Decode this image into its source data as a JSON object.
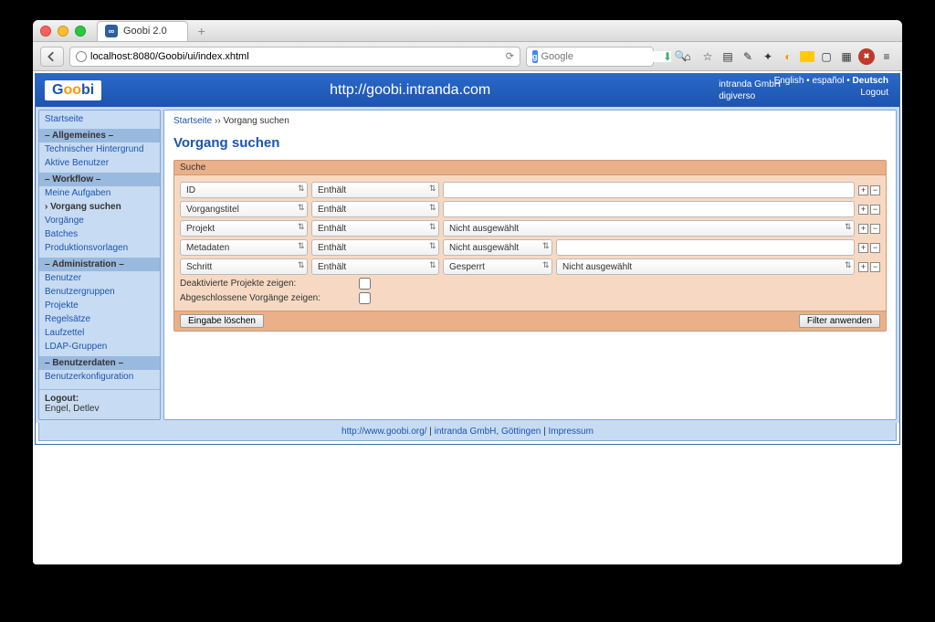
{
  "browser": {
    "tab_title": "Goobi 2.0",
    "url": "localhost:8080/Goobi/ui/index.xhtml",
    "search_placeholder": "Google"
  },
  "header": {
    "logo_prefix": "G",
    "logo_mid": "oo",
    "logo_suffix": "bi",
    "center_url": "http://goobi.intranda.com",
    "company": "intranda GmbH",
    "sub": "digiverso",
    "lang_en": "English",
    "lang_es": "español",
    "lang_de": "Deutsch",
    "logout": "Logout"
  },
  "sidebar": {
    "home": "Startseite",
    "g_allgemeines": "– Allgemeines –",
    "tech": "Technischer Hintergrund",
    "aktive": "Aktive Benutzer",
    "g_workflow": "– Workflow –",
    "meine": "Meine Aufgaben",
    "vorgang_suchen": "Vorgang suchen",
    "vorgaenge": "Vorgänge",
    "batches": "Batches",
    "prod": "Produktionsvorlagen",
    "g_admin": "– Administration –",
    "benutzer": "Benutzer",
    "gruppen": "Benutzergruppen",
    "projekte": "Projekte",
    "regel": "Regelsätze",
    "lauf": "Laufzettel",
    "ldap": "LDAP-Gruppen",
    "g_userdata": "– Benutzerdaten –",
    "userconf": "Benutzerkonfiguration",
    "logout_label": "Logout:",
    "user": "Engel, Detlev"
  },
  "main": {
    "breadcrumb_home": "Startseite",
    "breadcrumb_sep": "››",
    "breadcrumb_page": "Vorgang suchen",
    "title": "Vorgang suchen",
    "panel_title": "Suche",
    "fields": {
      "id": "ID",
      "vorgangstitel": "Vorgangstitel",
      "projekt": "Projekt",
      "metadaten": "Metadaten",
      "schritt": "Schritt"
    },
    "op_enthaelt": "Enthält",
    "nicht_ausgewaehlt": "Nicht ausgewählt",
    "gesperrt": "Gesperrt",
    "chk_deakt": "Deaktivierte Projekte zeigen:",
    "chk_abg": "Abgeschlossene Vorgänge zeigen:",
    "btn_clear": "Eingabe löschen",
    "btn_apply": "Filter anwenden"
  },
  "footer": {
    "goobi": "http://www.goobi.org/",
    "intranda": "intranda GmbH, Göttingen",
    "impressum": "Impressum"
  }
}
